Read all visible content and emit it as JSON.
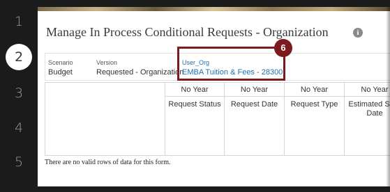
{
  "steps": [
    "1",
    "2",
    "3",
    "4",
    "5"
  ],
  "active_step": "2",
  "page": {
    "title": "Manage In Process Conditional Requests - Organization",
    "info_icon": "i"
  },
  "pov": [
    {
      "label": "Scenario",
      "value": "Budget"
    },
    {
      "label": "Version",
      "value": "Requested - Organization"
    },
    {
      "label": "User_Org",
      "value": "EMBA Tuition & Fees - 28300"
    }
  ],
  "grid": {
    "columns": [
      {
        "header": "No Year",
        "sub": "Request Status"
      },
      {
        "header": "No Year",
        "sub": "Request Date"
      },
      {
        "header": "No Year",
        "sub": "Request Type"
      },
      {
        "header": "No Year",
        "sub": "Estimated Start Date"
      }
    ],
    "empty_message": "There are no valid rows of data for this form."
  },
  "callout": {
    "number": "6",
    "color": "#7c1a1e"
  }
}
